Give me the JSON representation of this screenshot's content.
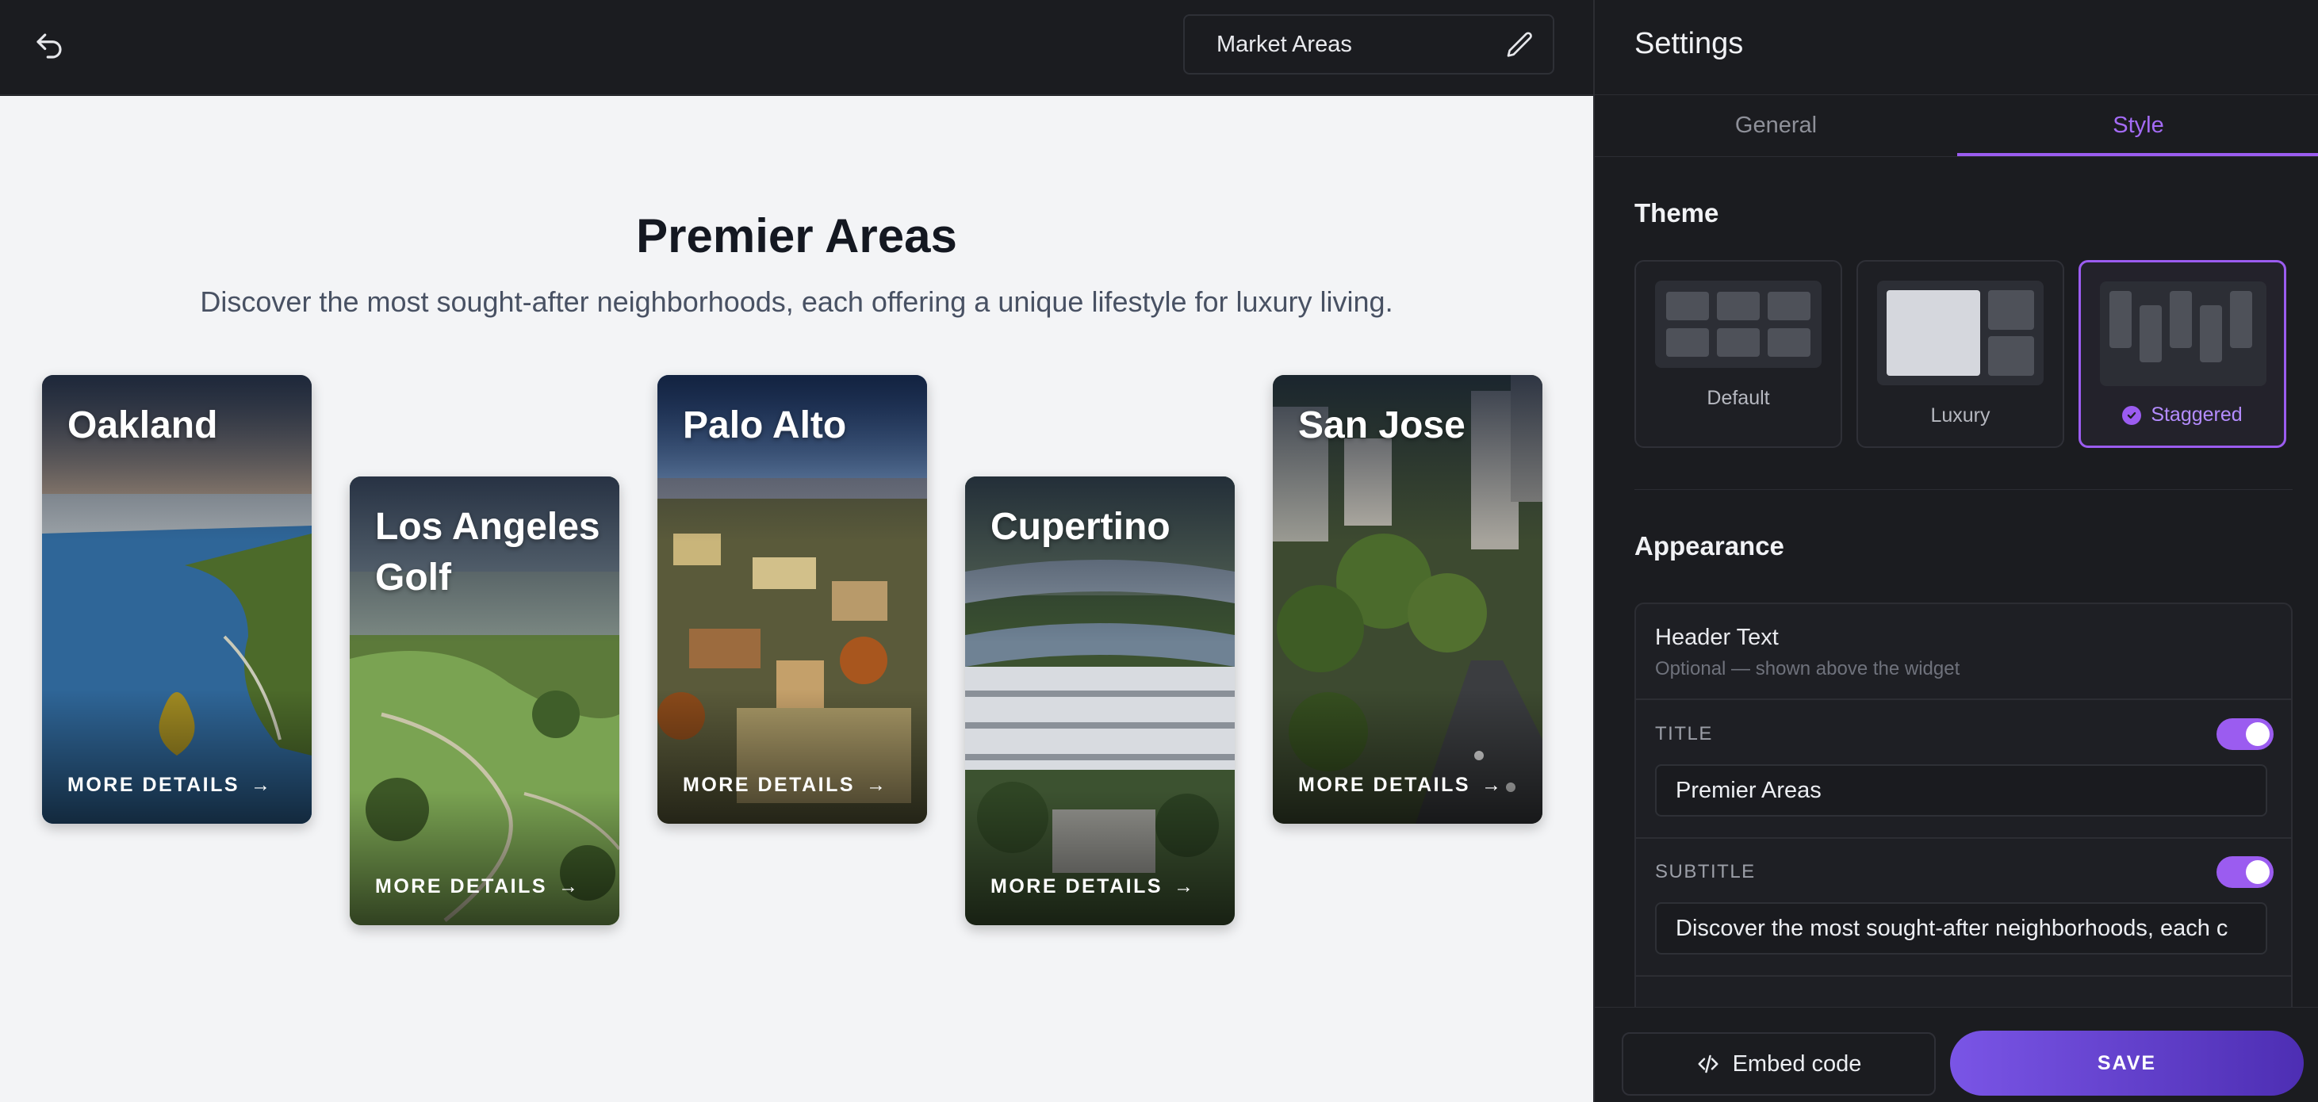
{
  "toolbar": {
    "widget_name": "Market Areas"
  },
  "preview": {
    "title": "Premier Areas",
    "subtitle": "Discover the most sought-after neighborhoods, each offering a unique lifestyle for luxury living.",
    "cards": [
      {
        "title": "Oakland",
        "link": "MORE DETAILS"
      },
      {
        "title": "Los Angeles Golf",
        "link": "MORE DETAILS"
      },
      {
        "title": "Palo Alto",
        "link": "MORE DETAILS"
      },
      {
        "title": "Cupertino",
        "link": "MORE DETAILS"
      },
      {
        "title": "San Jose",
        "link": "MORE DETAILS"
      }
    ]
  },
  "settings": {
    "title": "Settings",
    "tabs": {
      "general": "General",
      "style": "Style",
      "active": "Style"
    },
    "theme": {
      "heading": "Theme",
      "options": [
        "Default",
        "Luxury",
        "Staggered"
      ],
      "selected": "Staggered"
    },
    "appearance": {
      "heading": "Appearance",
      "header_text": "Header Text",
      "header_hint": "Optional — shown above the widget",
      "title_label": "TITLE",
      "title_value": "Premier Areas",
      "title_enabled": true,
      "subtitle_label": "SUBTITLE",
      "subtitle_value": "Discover the most sought-after neighborhoods, each c",
      "subtitle_enabled": true
    },
    "footer": {
      "embed_label": "Embed code",
      "save_label": "SAVE"
    }
  },
  "colors": {
    "accent": "#9b5cf0",
    "panel_bg": "#1b1c20",
    "canvas_bg": "#f3f4f6"
  }
}
